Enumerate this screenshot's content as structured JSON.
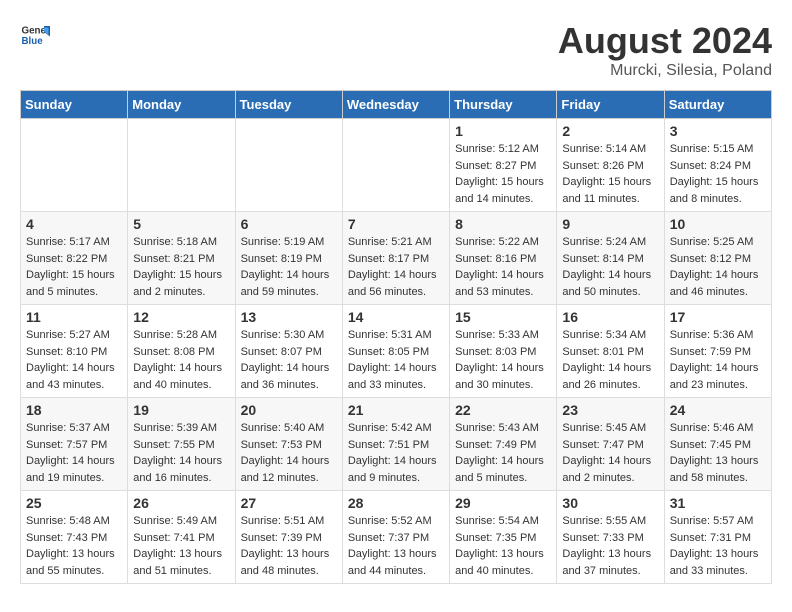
{
  "header": {
    "logo_general": "General",
    "logo_blue": "Blue",
    "title": "August 2024",
    "location": "Murcki, Silesia, Poland"
  },
  "days_of_week": [
    "Sunday",
    "Monday",
    "Tuesday",
    "Wednesday",
    "Thursday",
    "Friday",
    "Saturday"
  ],
  "weeks": [
    [
      {
        "day": "",
        "info": ""
      },
      {
        "day": "",
        "info": ""
      },
      {
        "day": "",
        "info": ""
      },
      {
        "day": "",
        "info": ""
      },
      {
        "day": "1",
        "info": "Sunrise: 5:12 AM\nSunset: 8:27 PM\nDaylight: 15 hours\nand 14 minutes."
      },
      {
        "day": "2",
        "info": "Sunrise: 5:14 AM\nSunset: 8:26 PM\nDaylight: 15 hours\nand 11 minutes."
      },
      {
        "day": "3",
        "info": "Sunrise: 5:15 AM\nSunset: 8:24 PM\nDaylight: 15 hours\nand 8 minutes."
      }
    ],
    [
      {
        "day": "4",
        "info": "Sunrise: 5:17 AM\nSunset: 8:22 PM\nDaylight: 15 hours\nand 5 minutes."
      },
      {
        "day": "5",
        "info": "Sunrise: 5:18 AM\nSunset: 8:21 PM\nDaylight: 15 hours\nand 2 minutes."
      },
      {
        "day": "6",
        "info": "Sunrise: 5:19 AM\nSunset: 8:19 PM\nDaylight: 14 hours\nand 59 minutes."
      },
      {
        "day": "7",
        "info": "Sunrise: 5:21 AM\nSunset: 8:17 PM\nDaylight: 14 hours\nand 56 minutes."
      },
      {
        "day": "8",
        "info": "Sunrise: 5:22 AM\nSunset: 8:16 PM\nDaylight: 14 hours\nand 53 minutes."
      },
      {
        "day": "9",
        "info": "Sunrise: 5:24 AM\nSunset: 8:14 PM\nDaylight: 14 hours\nand 50 minutes."
      },
      {
        "day": "10",
        "info": "Sunrise: 5:25 AM\nSunset: 8:12 PM\nDaylight: 14 hours\nand 46 minutes."
      }
    ],
    [
      {
        "day": "11",
        "info": "Sunrise: 5:27 AM\nSunset: 8:10 PM\nDaylight: 14 hours\nand 43 minutes."
      },
      {
        "day": "12",
        "info": "Sunrise: 5:28 AM\nSunset: 8:08 PM\nDaylight: 14 hours\nand 40 minutes."
      },
      {
        "day": "13",
        "info": "Sunrise: 5:30 AM\nSunset: 8:07 PM\nDaylight: 14 hours\nand 36 minutes."
      },
      {
        "day": "14",
        "info": "Sunrise: 5:31 AM\nSunset: 8:05 PM\nDaylight: 14 hours\nand 33 minutes."
      },
      {
        "day": "15",
        "info": "Sunrise: 5:33 AM\nSunset: 8:03 PM\nDaylight: 14 hours\nand 30 minutes."
      },
      {
        "day": "16",
        "info": "Sunrise: 5:34 AM\nSunset: 8:01 PM\nDaylight: 14 hours\nand 26 minutes."
      },
      {
        "day": "17",
        "info": "Sunrise: 5:36 AM\nSunset: 7:59 PM\nDaylight: 14 hours\nand 23 minutes."
      }
    ],
    [
      {
        "day": "18",
        "info": "Sunrise: 5:37 AM\nSunset: 7:57 PM\nDaylight: 14 hours\nand 19 minutes."
      },
      {
        "day": "19",
        "info": "Sunrise: 5:39 AM\nSunset: 7:55 PM\nDaylight: 14 hours\nand 16 minutes."
      },
      {
        "day": "20",
        "info": "Sunrise: 5:40 AM\nSunset: 7:53 PM\nDaylight: 14 hours\nand 12 minutes."
      },
      {
        "day": "21",
        "info": "Sunrise: 5:42 AM\nSunset: 7:51 PM\nDaylight: 14 hours\nand 9 minutes."
      },
      {
        "day": "22",
        "info": "Sunrise: 5:43 AM\nSunset: 7:49 PM\nDaylight: 14 hours\nand 5 minutes."
      },
      {
        "day": "23",
        "info": "Sunrise: 5:45 AM\nSunset: 7:47 PM\nDaylight: 14 hours\nand 2 minutes."
      },
      {
        "day": "24",
        "info": "Sunrise: 5:46 AM\nSunset: 7:45 PM\nDaylight: 13 hours\nand 58 minutes."
      }
    ],
    [
      {
        "day": "25",
        "info": "Sunrise: 5:48 AM\nSunset: 7:43 PM\nDaylight: 13 hours\nand 55 minutes."
      },
      {
        "day": "26",
        "info": "Sunrise: 5:49 AM\nSunset: 7:41 PM\nDaylight: 13 hours\nand 51 minutes."
      },
      {
        "day": "27",
        "info": "Sunrise: 5:51 AM\nSunset: 7:39 PM\nDaylight: 13 hours\nand 48 minutes."
      },
      {
        "day": "28",
        "info": "Sunrise: 5:52 AM\nSunset: 7:37 PM\nDaylight: 13 hours\nand 44 minutes."
      },
      {
        "day": "29",
        "info": "Sunrise: 5:54 AM\nSunset: 7:35 PM\nDaylight: 13 hours\nand 40 minutes."
      },
      {
        "day": "30",
        "info": "Sunrise: 5:55 AM\nSunset: 7:33 PM\nDaylight: 13 hours\nand 37 minutes."
      },
      {
        "day": "31",
        "info": "Sunrise: 5:57 AM\nSunset: 7:31 PM\nDaylight: 13 hours\nand 33 minutes."
      }
    ]
  ]
}
